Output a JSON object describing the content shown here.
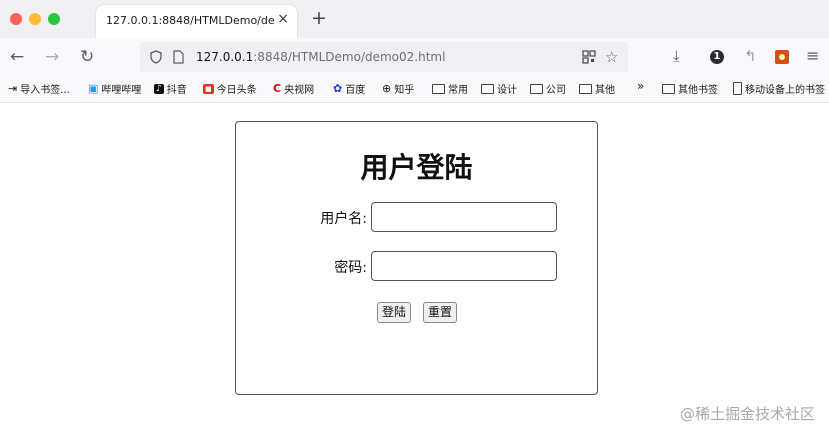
{
  "browser": {
    "tab_title": "127.0.0.1:8848/HTMLDemo/demo02.html",
    "close_glyph": "×",
    "new_tab_glyph": "+",
    "url_host": "127.0.0.1",
    "url_rest": ":8848/HTMLDemo/demo02.html",
    "badge_count": "1",
    "icons": [
      "back-icon",
      "forward-icon",
      "reload-icon",
      "shield-icon",
      "page-icon",
      "qr-icon",
      "star-icon",
      "download-icon",
      "notification-badge-icon",
      "reply-icon",
      "extension-icon",
      "menu-icon"
    ]
  },
  "bookmarks": {
    "items": [
      "导入书签...",
      "哔哩哔哩",
      "抖音",
      "今日头条",
      "央视网",
      "百度",
      "知乎",
      "常用",
      "设计",
      "公司",
      "其他"
    ],
    "overflow": "»",
    "other_bookmarks": "其他书签",
    "mobile_bookmarks": "移动设备上的书签"
  },
  "login": {
    "title": "用户登陆",
    "username_label": "用户名:",
    "password_label": "密码:",
    "username_value": "",
    "password_value": "",
    "login_button": "登陆",
    "reset_button": "重置"
  },
  "watermark": "@稀土掘金技术社区"
}
